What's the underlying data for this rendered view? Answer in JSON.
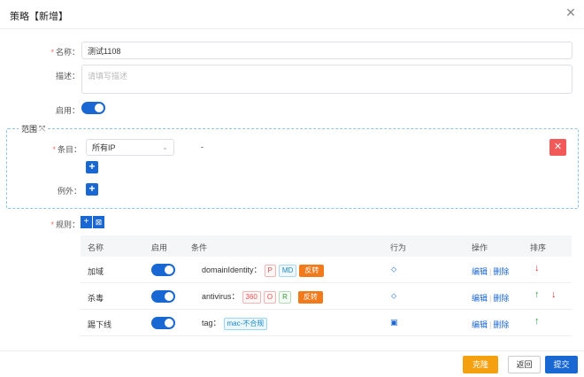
{
  "dialog": {
    "title": "策略【新增】",
    "close_icon": "close-icon"
  },
  "form": {
    "name_label": "名称：",
    "name_value": "测试1108",
    "desc_label": "描述：",
    "desc_placeholder": "请填写描述",
    "enable_label": "启用：",
    "enable_on": true
  },
  "scope": {
    "title": "范围",
    "entry_label": "条目：",
    "entry_value": "所有IP",
    "entry_dash": "-",
    "except_label": "例外："
  },
  "rules": {
    "label": "规则：",
    "add_btn": "+",
    "excel_btn": "⊠",
    "columns": [
      "名称",
      "启用",
      "条件",
      "行为",
      "操作",
      "排序"
    ],
    "rows": [
      {
        "name": "加域",
        "enabled": true,
        "condition_key": "domainIdentity：",
        "tags": [
          "P",
          "MD"
        ],
        "invert": "反转",
        "edit": "编辑",
        "delete": "删除",
        "sort": [
          "down"
        ]
      },
      {
        "name": "杀毒",
        "enabled": true,
        "condition_key": "antivirus：",
        "tags": [
          "360",
          "O",
          "R"
        ],
        "invert": "反转",
        "edit": "编辑",
        "delete": "删除",
        "sort": [
          "up",
          "down"
        ]
      },
      {
        "name": "踢下线",
        "enabled": true,
        "condition_key": "tag：",
        "tags": [
          "mac-不合规"
        ],
        "invert": "",
        "edit": "编辑",
        "delete": "删除",
        "sort": [
          "up"
        ]
      }
    ]
  },
  "footer": {
    "clone": "克隆",
    "back": "返回",
    "submit": "提交"
  },
  "colors": {
    "primary": "#1967d2",
    "danger": "#f25a5a",
    "clone": "#f5a10f",
    "invert": "#f27a1a"
  }
}
